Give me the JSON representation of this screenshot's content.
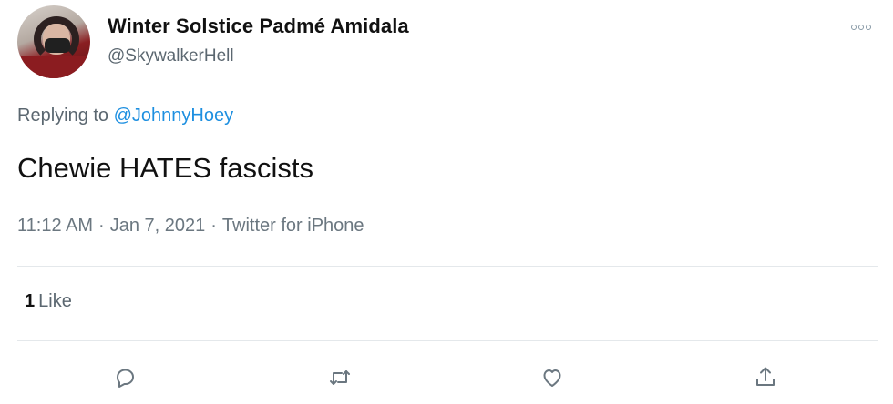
{
  "tweet": {
    "author": {
      "display_name": "Winter Solstice Padmé Amidala",
      "handle": "@SkywalkerHell",
      "avatar_icon": "profile-photo"
    },
    "more_icon": "more-horizontal-icon",
    "reply": {
      "prefix": "Replying to",
      "mention": "@JohnnyHoey"
    },
    "text": "Chewie HATES fascists",
    "meta": {
      "time": "11:12 AM",
      "separator": "·",
      "date": "Jan 7, 2021",
      "source": "Twitter for iPhone"
    },
    "stats": {
      "likes_count": "1",
      "likes_label": "Like"
    },
    "actions": {
      "reply_icon": "comment-icon",
      "retweet_icon": "retweet-icon",
      "like_icon": "heart-icon",
      "share_icon": "share-icon"
    },
    "colors": {
      "link": "#1d8fe0",
      "muted": "#5b6770",
      "divider": "#e4e8eb"
    }
  }
}
